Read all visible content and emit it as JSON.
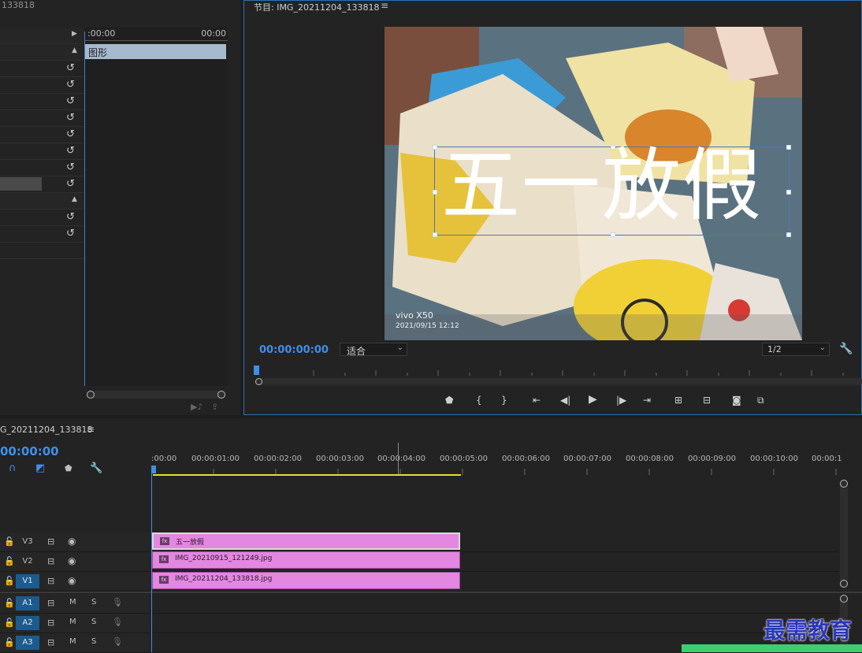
{
  "effect_controls": {
    "title_partial": "133818",
    "time_start": ":00:00",
    "time_end": "00:00",
    "clip_label": "图形",
    "reset_glyph": "↺"
  },
  "program_monitor": {
    "title": "节目: IMG_20211204_133818",
    "menu_glyph": "≡",
    "timecode": "00:00:00:00",
    "fit_option": "适合",
    "resolution": "1/2",
    "overlay_text": "五一放假",
    "watermark_model": "vivo X50",
    "watermark_date": "2021/09/15 12:12"
  },
  "timeline": {
    "sequence_name": "G_20211204_133818",
    "menu_glyph": "≡",
    "timecode": "00:00:00",
    "ruler": [
      ":00:00",
      "00:00:01:00",
      "00:00:02:00",
      "00:00:03:00",
      "00:00:04:00",
      "00:00:05:00",
      "00:00:06:00",
      "00:00:07:00",
      "00:00:08:00",
      "00:00:09:00",
      "00:00:10:00",
      "00:00:1"
    ],
    "tracks": [
      {
        "label": "V3",
        "targeted": false
      },
      {
        "label": "V2",
        "targeted": false
      },
      {
        "label": "V1",
        "targeted": true
      },
      {
        "label": "A1",
        "targeted": true
      },
      {
        "label": "A2",
        "targeted": true
      },
      {
        "label": "A3",
        "targeted": true
      }
    ],
    "clips": [
      {
        "name": "五一放假"
      },
      {
        "name": "IMG_20210915_121249.jpg"
      },
      {
        "name": "IMG_20211204_133818.jpg"
      }
    ],
    "mute_label": "M",
    "solo_label": "S"
  },
  "brand_watermark": "最需教育",
  "colors": {
    "accent": "#2d8ceb",
    "clip": "#e387e0",
    "track_target": "#1c5b8e",
    "brand": "#2a37b8",
    "highlight": "#3fcd74"
  }
}
